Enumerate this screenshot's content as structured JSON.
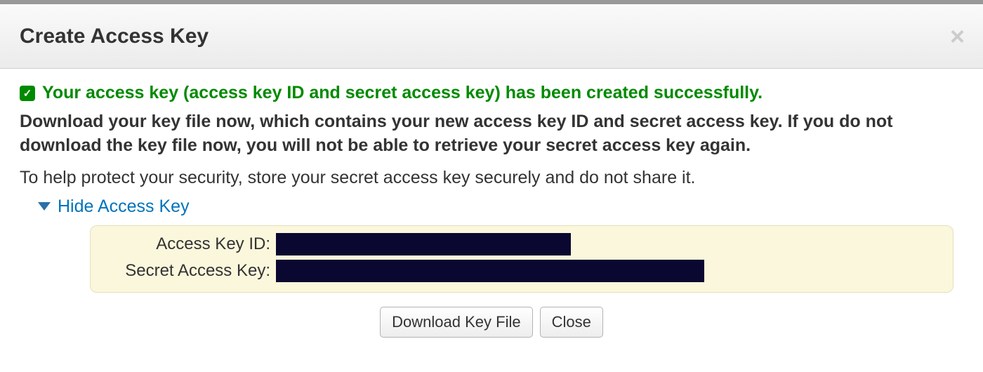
{
  "header": {
    "title": "Create Access Key"
  },
  "success": {
    "message": "Your access key (access key ID and secret access key) has been created successfully."
  },
  "warning": "Download your key file now, which contains your new access key ID and secret access key. If you do not download the key file now, you will not be able to retrieve your secret access key again.",
  "info": "To help protect your security, store your secret access key securely and do not share it.",
  "toggle": {
    "label": "Hide Access Key"
  },
  "keys": {
    "access_key_id_label": "Access Key ID:",
    "secret_access_key_label": "Secret Access Key:"
  },
  "buttons": {
    "download": "Download Key File",
    "close": "Close"
  }
}
